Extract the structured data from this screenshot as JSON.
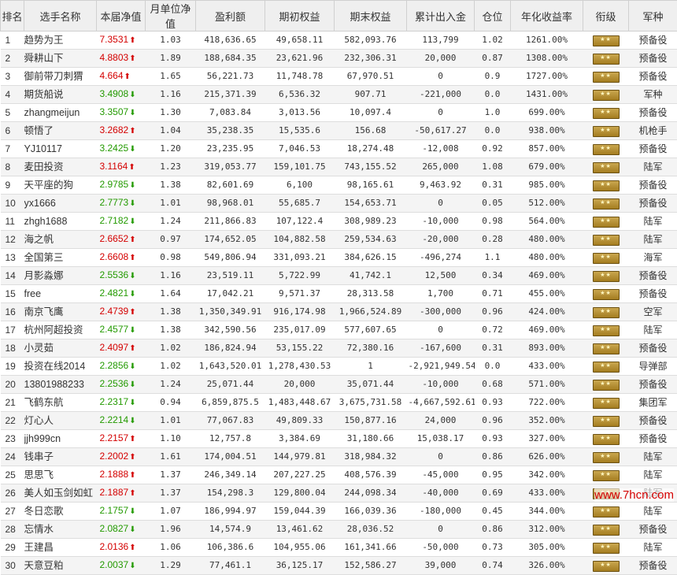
{
  "headers": [
    "排名",
    "选手名称",
    "本届净值",
    "月单位净值",
    "盈利额",
    "期初权益",
    "期末权益",
    "累计出入金",
    "仓位",
    "年化收益率",
    "衔级",
    "军种"
  ],
  "rows": [
    {
      "rank": "1",
      "name": "趋势为王",
      "nav": "7.3531",
      "dir": "up",
      "month": "1.03",
      "profit": "418,636.65",
      "start": "49,658.11",
      "end": "582,093.76",
      "flow": "113,799",
      "pos": "1.02",
      "annual": "1261.00%",
      "branch": "预备役"
    },
    {
      "rank": "2",
      "name": "舜耕山下",
      "nav": "4.8803",
      "dir": "up",
      "month": "1.89",
      "profit": "188,684.35",
      "start": "23,621.96",
      "end": "232,306.31",
      "flow": "20,000",
      "pos": "0.87",
      "annual": "1308.00%",
      "branch": "预备役"
    },
    {
      "rank": "3",
      "name": "御前带刀刺猬",
      "nav": "4.664",
      "dir": "up",
      "month": "1.65",
      "profit": "56,221.73",
      "start": "11,748.78",
      "end": "67,970.51",
      "flow": "0",
      "pos": "0.9",
      "annual": "1727.00%",
      "branch": "预备役"
    },
    {
      "rank": "4",
      "name": "期货船说",
      "nav": "3.4908",
      "dir": "down",
      "month": "1.16",
      "profit": "215,371.39",
      "start": "6,536.32",
      "end": "907.71",
      "flow": "-221,000",
      "pos": "0.0",
      "annual": "1431.00%",
      "branch": "军种"
    },
    {
      "rank": "5",
      "name": "zhangmeijun",
      "nav": "3.3507",
      "dir": "down",
      "month": "1.30",
      "profit": "7,083.84",
      "start": "3,013.56",
      "end": "10,097.4",
      "flow": "0",
      "pos": "1.0",
      "annual": "699.00%",
      "branch": "预备役"
    },
    {
      "rank": "6",
      "name": "顿悟了",
      "nav": "3.2682",
      "dir": "up",
      "month": "1.04",
      "profit": "35,238.35",
      "start": "15,535.6",
      "end": "156.68",
      "flow": "-50,617.27",
      "pos": "0.0",
      "annual": "938.00%",
      "branch": "机枪手"
    },
    {
      "rank": "7",
      "name": "YJ10117",
      "nav": "3.2425",
      "dir": "down",
      "month": "1.20",
      "profit": "23,235.95",
      "start": "7,046.53",
      "end": "18,274.48",
      "flow": "-12,008",
      "pos": "0.92",
      "annual": "857.00%",
      "branch": "预备役"
    },
    {
      "rank": "8",
      "name": "麦田投资",
      "nav": "3.1164",
      "dir": "up",
      "month": "1.23",
      "profit": "319,053.77",
      "start": "159,101.75",
      "end": "743,155.52",
      "flow": "265,000",
      "pos": "1.08",
      "annual": "679.00%",
      "branch": "陆军"
    },
    {
      "rank": "9",
      "name": "天平座的狗",
      "nav": "2.9785",
      "dir": "down",
      "month": "1.38",
      "profit": "82,601.69",
      "start": "6,100",
      "end": "98,165.61",
      "flow": "9,463.92",
      "pos": "0.31",
      "annual": "985.00%",
      "branch": "预备役"
    },
    {
      "rank": "10",
      "name": "yx1666",
      "nav": "2.7773",
      "dir": "down",
      "month": "1.01",
      "profit": "98,968.01",
      "start": "55,685.7",
      "end": "154,653.71",
      "flow": "0",
      "pos": "0.05",
      "annual": "512.00%",
      "branch": "预备役"
    },
    {
      "rank": "11",
      "name": "zhgh1688",
      "nav": "2.7182",
      "dir": "down",
      "month": "1.24",
      "profit": "211,866.83",
      "start": "107,122.4",
      "end": "308,989.23",
      "flow": "-10,000",
      "pos": "0.98",
      "annual": "564.00%",
      "branch": "陆军"
    },
    {
      "rank": "12",
      "name": "海之帆",
      "nav": "2.6652",
      "dir": "up",
      "month": "0.97",
      "profit": "174,652.05",
      "start": "104,882.58",
      "end": "259,534.63",
      "flow": "-20,000",
      "pos": "0.28",
      "annual": "480.00%",
      "branch": "陆军"
    },
    {
      "rank": "13",
      "name": "全国第三",
      "nav": "2.6608",
      "dir": "up",
      "month": "0.98",
      "profit": "549,806.94",
      "start": "331,093.21",
      "end": "384,626.15",
      "flow": "-496,274",
      "pos": "1.1",
      "annual": "480.00%",
      "branch": "海军"
    },
    {
      "rank": "14",
      "name": "月影淼娜",
      "nav": "2.5536",
      "dir": "down",
      "month": "1.16",
      "profit": "23,519.11",
      "start": "5,722.99",
      "end": "41,742.1",
      "flow": "12,500",
      "pos": "0.34",
      "annual": "469.00%",
      "branch": "预备役"
    },
    {
      "rank": "15",
      "name": "free",
      "nav": "2.4821",
      "dir": "down",
      "month": "1.64",
      "profit": "17,042.21",
      "start": "9,571.37",
      "end": "28,313.58",
      "flow": "1,700",
      "pos": "0.71",
      "annual": "455.00%",
      "branch": "预备役"
    },
    {
      "rank": "16",
      "name": "南京飞鹰",
      "nav": "2.4739",
      "dir": "up",
      "month": "1.38",
      "profit": "1,350,349.91",
      "start": "916,174.98",
      "end": "1,966,524.89",
      "flow": "-300,000",
      "pos": "0.96",
      "annual": "424.00%",
      "branch": "空军"
    },
    {
      "rank": "17",
      "name": "杭州阿超投资",
      "nav": "2.4577",
      "dir": "down",
      "month": "1.38",
      "profit": "342,590.56",
      "start": "235,017.09",
      "end": "577,607.65",
      "flow": "0",
      "pos": "0.72",
      "annual": "469.00%",
      "branch": "陆军"
    },
    {
      "rank": "18",
      "name": "小灵茹",
      "nav": "2.4097",
      "dir": "up",
      "month": "1.02",
      "profit": "186,824.94",
      "start": "53,155.22",
      "end": "72,380.16",
      "flow": "-167,600",
      "pos": "0.31",
      "annual": "893.00%",
      "branch": "预备役"
    },
    {
      "rank": "19",
      "name": "投资在线2014",
      "nav": "2.2856",
      "dir": "down",
      "month": "1.02",
      "profit": "1,643,520.01",
      "start": "1,278,430.53",
      "end": "1",
      "flow": "-2,921,949.54",
      "pos": "0.0",
      "annual": "433.00%",
      "branch": "导弹部"
    },
    {
      "rank": "20",
      "name": "13801988233",
      "nav": "2.2536",
      "dir": "down",
      "month": "1.24",
      "profit": "25,071.44",
      "start": "20,000",
      "end": "35,071.44",
      "flow": "-10,000",
      "pos": "0.68",
      "annual": "571.00%",
      "branch": "预备役"
    },
    {
      "rank": "21",
      "name": "飞鹤东航",
      "nav": "2.2317",
      "dir": "down",
      "month": "0.94",
      "profit": "6,859,875.5",
      "start": "1,483,448.67",
      "end": "3,675,731.58",
      "flow": "-4,667,592.61",
      "pos": "0.93",
      "annual": "722.00%",
      "branch": "集团军"
    },
    {
      "rank": "22",
      "name": "灯心人",
      "nav": "2.2214",
      "dir": "down",
      "month": "1.01",
      "profit": "77,067.83",
      "start": "49,809.33",
      "end": "150,877.16",
      "flow": "24,000",
      "pos": "0.96",
      "annual": "352.00%",
      "branch": "预备役"
    },
    {
      "rank": "23",
      "name": "jjh999cn",
      "nav": "2.2157",
      "dir": "up",
      "month": "1.10",
      "profit": "12,757.8",
      "start": "3,384.69",
      "end": "31,180.66",
      "flow": "15,038.17",
      "pos": "0.93",
      "annual": "327.00%",
      "branch": "预备役"
    },
    {
      "rank": "24",
      "name": "钱串子",
      "nav": "2.2002",
      "dir": "up",
      "month": "1.61",
      "profit": "174,004.51",
      "start": "144,979.81",
      "end": "318,984.32",
      "flow": "0",
      "pos": "0.86",
      "annual": "626.00%",
      "branch": "陆军"
    },
    {
      "rank": "25",
      "name": "思思飞",
      "nav": "2.1888",
      "dir": "up",
      "month": "1.37",
      "profit": "246,349.14",
      "start": "207,227.25",
      "end": "408,576.39",
      "flow": "-45,000",
      "pos": "0.95",
      "annual": "342.00%",
      "branch": "陆军"
    },
    {
      "rank": "26",
      "name": "美人如玉剑如虹",
      "nav": "2.1887",
      "dir": "up",
      "month": "1.37",
      "profit": "154,298.3",
      "start": "129,800.04",
      "end": "244,098.34",
      "flow": "-40,000",
      "pos": "0.69",
      "annual": "433.00%",
      "branch": "陆军"
    },
    {
      "rank": "27",
      "name": "冬日恋歌",
      "nav": "2.1757",
      "dir": "down",
      "month": "1.07",
      "profit": "186,994.97",
      "start": "159,044.39",
      "end": "166,039.36",
      "flow": "-180,000",
      "pos": "0.45",
      "annual": "344.00%",
      "branch": "陆军"
    },
    {
      "rank": "28",
      "name": "忘情水",
      "nav": "2.0827",
      "dir": "down",
      "month": "1.96",
      "profit": "14,574.9",
      "start": "13,461.62",
      "end": "28,036.52",
      "flow": "0",
      "pos": "0.86",
      "annual": "312.00%",
      "branch": "预备役"
    },
    {
      "rank": "29",
      "name": "王建昌",
      "nav": "2.0136",
      "dir": "up",
      "month": "1.06",
      "profit": "106,386.6",
      "start": "104,955.06",
      "end": "161,341.66",
      "flow": "-50,000",
      "pos": "0.73",
      "annual": "305.00%",
      "branch": "陆军"
    },
    {
      "rank": "30",
      "name": "天意豆粕",
      "nav": "2.0037",
      "dir": "down",
      "month": "1.29",
      "profit": "77,461.1",
      "start": "36,125.17",
      "end": "152,586.27",
      "flow": "39,000",
      "pos": "0.74",
      "annual": "326.00%",
      "branch": "预备役"
    }
  ],
  "watermark": "www.7hcn.com",
  "colors": {
    "up": "#d40000",
    "down": "#239a00",
    "header_bg": "#efefef"
  },
  "icons": {
    "up": "red-up-arrow-icon",
    "down": "green-down-arrow-icon",
    "rank": "rank-badge-icon"
  }
}
